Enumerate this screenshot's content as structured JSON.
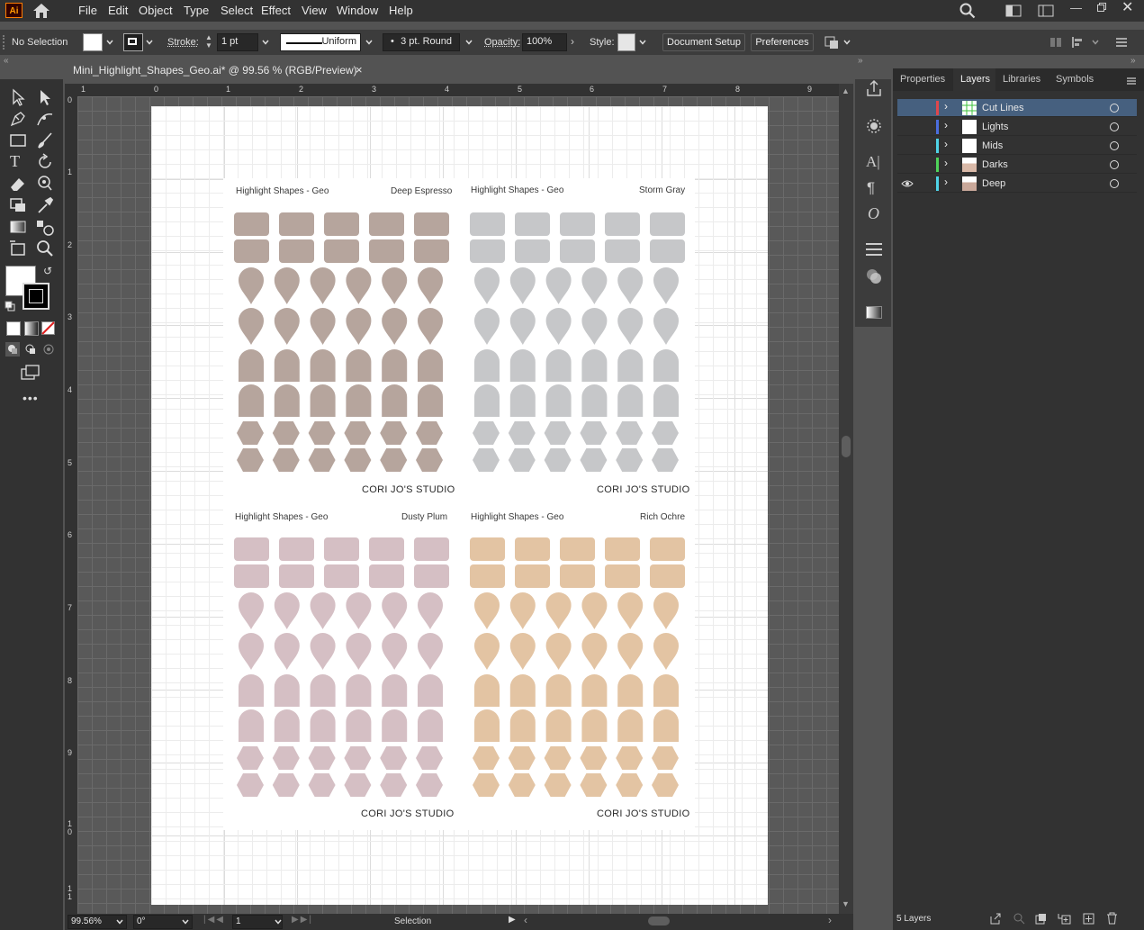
{
  "app": {
    "logo_text": "Ai"
  },
  "menu": [
    "File",
    "Edit",
    "Object",
    "Type",
    "Select",
    "Effect",
    "View",
    "Window",
    "Help"
  ],
  "control": {
    "selection": "No Selection",
    "stroke_label": "Stroke:",
    "stroke_value": "1 pt",
    "stroke_style": "Uniform",
    "brush": "3 pt. Round",
    "opacity_label": "Opacity:",
    "opacity_value": "100%",
    "style_label": "Style:",
    "document_setup": "Document Setup",
    "preferences": "Preferences"
  },
  "document_tab": {
    "title": "Mini_Highlight_Shapes_Geo.ai* @ 99.56 % (RGB/Preview)",
    "close": "×"
  },
  "rulers": {
    "horizontal": [
      "1",
      "0",
      "1",
      "2",
      "3",
      "4",
      "5",
      "6",
      "7",
      "8",
      "9"
    ],
    "vertical": [
      "0",
      "1",
      "2",
      "3",
      "4",
      "5",
      "6",
      "7",
      "8",
      "9",
      "1 0",
      "1 1"
    ]
  },
  "sheets": [
    {
      "title": "Highlight Shapes - Geo",
      "color_name": "Deep Espresso",
      "studio": "CORI JO'S STUDIO",
      "color": "#b6a59d"
    },
    {
      "title": "Highlight Shapes - Geo",
      "color_name": "Storm Gray",
      "studio": "CORI JO'S STUDIO",
      "color": "#c6c7c9"
    },
    {
      "title": "Highlight Shapes - Geo",
      "color_name": "Dusty Plum",
      "studio": "CORI JO'S STUDIO",
      "color": "#d5bfc4"
    },
    {
      "title": "Highlight Shapes - Geo",
      "color_name": "Rich Ochre",
      "studio": "CORI JO'S STUDIO",
      "color": "#e3c4a3"
    }
  ],
  "panel": {
    "tabs": [
      "Properties",
      "Layers",
      "Libraries",
      "Symbols"
    ],
    "active_tab": "Layers",
    "layers": [
      {
        "name": "Cut Lines",
        "color": "#e0474c",
        "selected": true,
        "visible": false
      },
      {
        "name": "Lights",
        "color": "#4b6ee0",
        "selected": false,
        "visible": false
      },
      {
        "name": "Mids",
        "color": "#4fd4e8",
        "selected": false,
        "visible": false
      },
      {
        "name": "Darks",
        "color": "#4fd45a",
        "selected": false,
        "visible": false
      },
      {
        "name": "Deep",
        "color": "#4fd4e8",
        "selected": false,
        "visible": true
      }
    ],
    "footer": "5 Layers"
  },
  "status": {
    "zoom": "99.56%",
    "rotation": "0°",
    "artboard": "1",
    "mode": "Selection"
  }
}
